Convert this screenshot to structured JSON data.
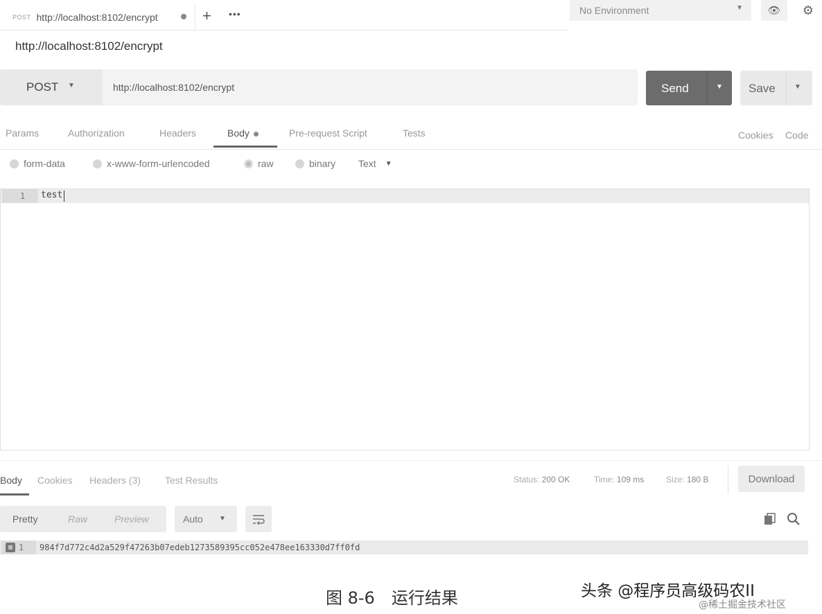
{
  "tab": {
    "method": "POST",
    "url": "http://localhost:8102/encrypt",
    "plus": "+",
    "more": "•••"
  },
  "environment": {
    "label": "No Environment"
  },
  "request": {
    "title": "http://localhost:8102/encrypt",
    "method": "POST",
    "url": "http://localhost:8102/encrypt",
    "send_label": "Send",
    "save_label": "Save"
  },
  "request_tabs": {
    "params": "Params",
    "authorization": "Authorization",
    "headers": "Headers",
    "body": "Body",
    "prerequest": "Pre-request Script",
    "tests": "Tests",
    "cookies": "Cookies",
    "code": "Code"
  },
  "body_types": {
    "form_data": "form-data",
    "urlencoded": "x-www-form-urlencoded",
    "raw": "raw",
    "binary": "binary",
    "text_format": "Text",
    "selected": "raw"
  },
  "editor": {
    "line_number": "1",
    "content": "test"
  },
  "response_tabs": {
    "body": "Body",
    "cookies": "Cookies",
    "headers": "Headers (3)",
    "test_results": "Test Results"
  },
  "response_status": {
    "status_label": "Status:",
    "status_value": "200 OK",
    "time_label": "Time:",
    "time_value": "109 ms",
    "size_label": "Size:",
    "size_value": "180 B"
  },
  "download_label": "Download",
  "view_modes": {
    "pretty": "Pretty",
    "raw": "Raw",
    "preview": "Preview",
    "format": "Auto"
  },
  "response_body": {
    "line_number": "1",
    "content": "984f7d772c4d2a529f47263b07edeb1273589395cc052e478ee163330d7ff0fd"
  },
  "caption": "图 8-6　运行结果",
  "watermark": {
    "main": "头条 @程序员高级码农II",
    "sub": "@稀土掘金技术社区"
  }
}
